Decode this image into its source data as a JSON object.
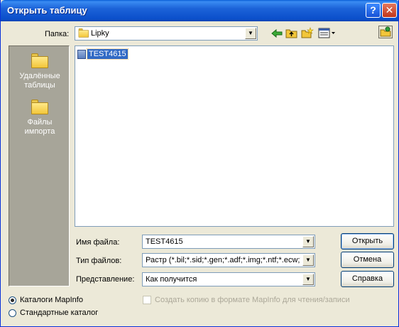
{
  "window": {
    "title": "Открыть таблицу",
    "help_button": "?",
    "close_button": "✕"
  },
  "folder_bar": {
    "label": "Папка:",
    "current_folder": "Lipky",
    "toolbar_icons": [
      "back-arrow-icon",
      "up-folder-icon",
      "new-folder-icon",
      "view-menu-icon",
      "mapinfo-places-icon"
    ]
  },
  "places": [
    {
      "label_line1": "Удалённые",
      "label_line2": "таблицы",
      "icon": "folder-icon"
    },
    {
      "label_line1": "Файлы",
      "label_line2": "импорта",
      "icon": "folder-icon"
    }
  ],
  "files": [
    {
      "name": "TEST4615",
      "icon": "raster-file-icon",
      "selected": true
    }
  ],
  "fields": {
    "filename_label": "Имя файла:",
    "filename_value": "TEST4615",
    "filetype_label": "Тип файлов:",
    "filetype_value": "Растр (*.bil;*.sid;*.gen;*.adf;*.img;*.ntf;*.ecw;*.u",
    "view_label": "Представление:",
    "view_value": "Как получится"
  },
  "buttons": {
    "open": "Открыть",
    "cancel": "Отмена",
    "help": "Справка"
  },
  "options": {
    "radio_mapinfo": "Каталоги MapInfo",
    "radio_standard": "Стандартные каталог",
    "selected_radio": "mapinfo",
    "copy_checkbox": "Создать копию в формате MapInfo для чтения/записи",
    "copy_checked": false,
    "copy_enabled": false
  },
  "colors": {
    "titlebar": "#0a4fcb",
    "dialog_bg": "#ece9d8",
    "places_bg": "#a7a599",
    "selection": "#316ac5"
  }
}
